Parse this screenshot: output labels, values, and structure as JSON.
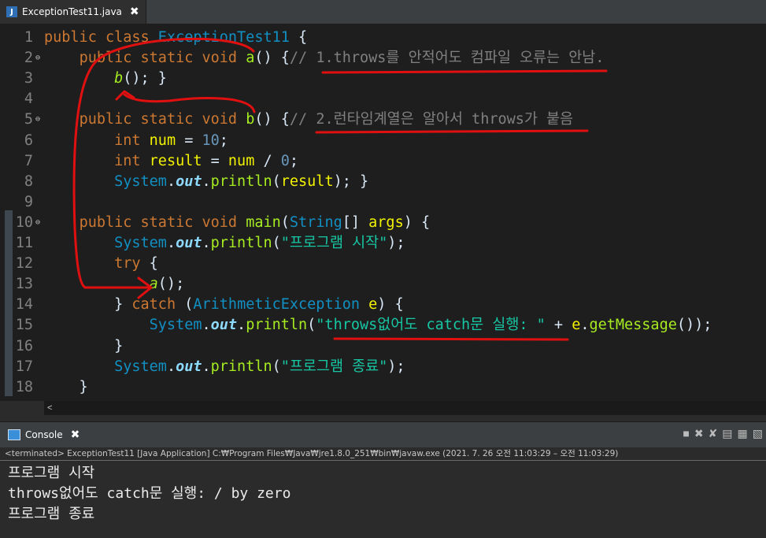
{
  "editor": {
    "tab_title": "ExceptionTest11.java",
    "file_icon_glyph": "J",
    "close_glyph": "✖",
    "line_numbers": [
      "1",
      "2",
      "3",
      "4",
      "5",
      "6",
      "7",
      "8",
      "9",
      "10",
      "11",
      "12",
      "13",
      "14",
      "15",
      "16",
      "17",
      "18"
    ],
    "fold_glyph": "⊖",
    "lines": [
      [
        [
          "kw",
          "public "
        ],
        [
          "kw",
          "class "
        ],
        [
          "typ",
          "ExceptionTest11"
        ],
        [
          "pl",
          " {"
        ]
      ],
      [
        [
          "pl",
          "    "
        ],
        [
          "kw",
          "public "
        ],
        [
          "kw",
          "static "
        ],
        [
          "kw",
          "void "
        ],
        [
          "mth",
          "a"
        ],
        [
          "pl",
          "() {"
        ],
        [
          "cmt",
          "// 1.throws를 안적어도 컴파일 오류는 안남."
        ]
      ],
      [
        [
          "pl",
          "        "
        ],
        [
          "ital-m",
          "b"
        ],
        [
          "pl",
          "(); }"
        ]
      ],
      [
        [
          "pl",
          ""
        ]
      ],
      [
        [
          "pl",
          "    "
        ],
        [
          "kw",
          "public "
        ],
        [
          "kw",
          "static "
        ],
        [
          "kw",
          "void "
        ],
        [
          "mth",
          "b"
        ],
        [
          "pl",
          "() {"
        ],
        [
          "cmt",
          "// 2.런타임계열은 알아서 throws가 붙음"
        ]
      ],
      [
        [
          "pl",
          "        "
        ],
        [
          "kw",
          "int "
        ],
        [
          "var",
          "num"
        ],
        [
          "pl",
          " = "
        ],
        [
          "num",
          "10"
        ],
        [
          "pl",
          ";"
        ]
      ],
      [
        [
          "pl",
          "        "
        ],
        [
          "kw",
          "int "
        ],
        [
          "var",
          "result"
        ],
        [
          "pl",
          " = "
        ],
        [
          "var",
          "num"
        ],
        [
          "pl",
          " / "
        ],
        [
          "num",
          "0"
        ],
        [
          "pl",
          ";"
        ]
      ],
      [
        [
          "pl",
          "        "
        ],
        [
          "typ",
          "System"
        ],
        [
          "pl",
          "."
        ],
        [
          "sfld",
          "out"
        ],
        [
          "pl",
          "."
        ],
        [
          "mth",
          "println"
        ],
        [
          "pl",
          "("
        ],
        [
          "var",
          "result"
        ],
        [
          "pl",
          "); }"
        ]
      ],
      [
        [
          "pl",
          ""
        ]
      ],
      [
        [
          "pl",
          "    "
        ],
        [
          "kw",
          "public "
        ],
        [
          "kw",
          "static "
        ],
        [
          "kw",
          "void "
        ],
        [
          "mth",
          "main"
        ],
        [
          "pl",
          "("
        ],
        [
          "typ",
          "String"
        ],
        [
          "pl",
          "[] "
        ],
        [
          "var",
          "args"
        ],
        [
          "pl",
          ") {"
        ]
      ],
      [
        [
          "pl",
          "        "
        ],
        [
          "typ",
          "System"
        ],
        [
          "pl",
          "."
        ],
        [
          "sfld",
          "out"
        ],
        [
          "pl",
          "."
        ],
        [
          "mth",
          "println"
        ],
        [
          "pl",
          "("
        ],
        [
          "str",
          "\"프로그램 시작\""
        ],
        [
          "pl",
          ");"
        ]
      ],
      [
        [
          "pl",
          "        "
        ],
        [
          "kw",
          "try"
        ],
        [
          "pl",
          " {"
        ]
      ],
      [
        [
          "pl",
          "            "
        ],
        [
          "ital-m",
          "a"
        ],
        [
          "pl",
          "();"
        ]
      ],
      [
        [
          "pl",
          "        } "
        ],
        [
          "kw",
          "catch"
        ],
        [
          "pl",
          " ("
        ],
        [
          "typ",
          "ArithmeticException"
        ],
        [
          "pl",
          " "
        ],
        [
          "var",
          "e"
        ],
        [
          "pl",
          ") {"
        ]
      ],
      [
        [
          "pl",
          "            "
        ],
        [
          "typ",
          "System"
        ],
        [
          "pl",
          "."
        ],
        [
          "sfld",
          "out"
        ],
        [
          "pl",
          "."
        ],
        [
          "mth",
          "println"
        ],
        [
          "pl",
          "("
        ],
        [
          "str",
          "\"throws없어도 catch문 실행: \""
        ],
        [
          "pl",
          " + "
        ],
        [
          "var",
          "e"
        ],
        [
          "pl",
          "."
        ],
        [
          "mth",
          "getMessage"
        ],
        [
          "pl",
          "());"
        ]
      ],
      [
        [
          "pl",
          "        }"
        ]
      ],
      [
        [
          "pl",
          "        "
        ],
        [
          "typ",
          "System"
        ],
        [
          "pl",
          "."
        ],
        [
          "sfld",
          "out"
        ],
        [
          "pl",
          "."
        ],
        [
          "mth",
          "println"
        ],
        [
          "pl",
          "("
        ],
        [
          "str",
          "\"프로그램 종료\""
        ],
        [
          "pl",
          ");"
        ]
      ],
      [
        [
          "pl",
          "    }"
        ]
      ]
    ],
    "fold_on_lines": [
      2,
      5,
      10
    ],
    "hscroll_glyph": "<"
  },
  "console": {
    "tab_title": "Console",
    "close_glyph": "✖",
    "toolbar_icons": [
      "stop-icon",
      "remove-launch-icon",
      "remove-all-icon",
      "pin-console-icon",
      "open-console-icon",
      "display-console-icon"
    ],
    "toolbar_glyphs": [
      "■",
      "✖",
      "✘",
      "▤",
      "▦",
      "▧"
    ],
    "status": "<terminated> ExceptionTest11 [Java Application] C:₩Program Files₩Java₩jre1.8.0_251₩bin₩javaw.exe  (2021. 7. 26 오전 11:03:29 – 오전 11:03:29)",
    "output": [
      "프로그램 시작",
      "throws없어도 catch문 실행: / by zero",
      "프로그램 종료"
    ]
  },
  "colors": {
    "annotation_red": "#e01010",
    "editor_bg": "#1e1e1e",
    "keyword": "#cc7832",
    "type": "#1290c3",
    "method": "#a7ec21",
    "string": "#17c6a3",
    "comment": "#808080"
  }
}
